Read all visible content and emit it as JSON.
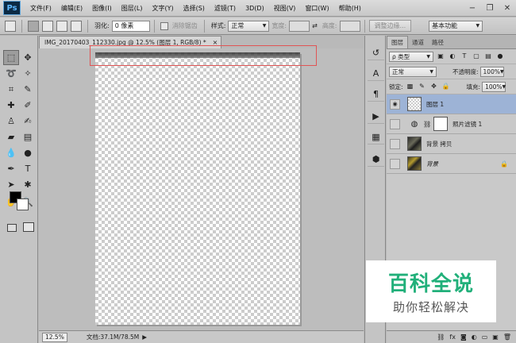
{
  "app": {
    "logo": "Ps"
  },
  "menubar": {
    "items": [
      "文件(F)",
      "编辑(E)",
      "图像(I)",
      "图层(L)",
      "文字(Y)",
      "选择(S)",
      "滤镜(T)",
      "3D(D)",
      "视图(V)",
      "窗口(W)",
      "帮助(H)"
    ]
  },
  "window_controls": {
    "minimize": "−",
    "restore": "❐",
    "close": "✕"
  },
  "options": {
    "feather_label": "羽化:",
    "feather_value": "0 像素",
    "antialias_label": "消除锯齿",
    "style_label": "样式:",
    "style_value": "正常",
    "width_label": "宽度:",
    "height_label": "高度:",
    "refine_edge": "调整边缘...",
    "workspace": "基本功能"
  },
  "document": {
    "tab_title": "IMG_20170403_112330.jpg @ 12.5% (图层 1, RGB/8) *",
    "tab_close": "×"
  },
  "status": {
    "zoom": "12.5%",
    "doc_size": "文档:37.1M/78.5M",
    "arrow": "▶"
  },
  "layers_panel": {
    "tabs": [
      "图层",
      "通道",
      "路径"
    ],
    "filter_kind": "ρ 类型",
    "blend_mode": "正常",
    "opacity_label": "不透明度:",
    "opacity_value": "100%",
    "lock_label": "锁定:",
    "fill_label": "填充:",
    "fill_value": "100%",
    "layers": [
      {
        "name": "图层 1",
        "visible": true,
        "selected": true
      },
      {
        "name": "照片滤镜 1",
        "visible": false,
        "selected": false
      },
      {
        "name": "背景 拷贝",
        "visible": false,
        "selected": false
      },
      {
        "name": "背景",
        "visible": false,
        "selected": false,
        "locked": true
      }
    ],
    "footer_icons": [
      "link-icon",
      "fx-icon",
      "mask-icon",
      "adjustment-icon",
      "group-icon",
      "new-layer-icon",
      "trash-icon"
    ]
  },
  "watermark": {
    "title": "百科全说",
    "subtitle": "助你轻松解决"
  },
  "colors": {
    "accent_selected_layer": "#9db3d6",
    "selection_outline": "#e05555",
    "watermark_green": "#21b07a"
  }
}
